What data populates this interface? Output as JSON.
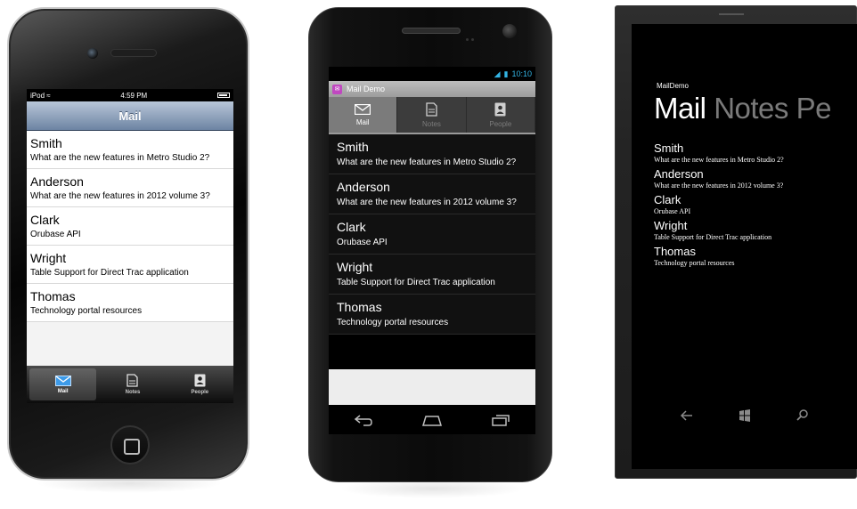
{
  "messages": [
    {
      "sender": "Smith",
      "subject": "What are the new features in Metro Studio 2?"
    },
    {
      "sender": "Anderson",
      "subject": "What are the new features in 2012 volume 3?"
    },
    {
      "sender": "Clark",
      "subject": "Orubase API"
    },
    {
      "sender": "Wright",
      "subject": "Table Support for Direct Trac application"
    },
    {
      "sender": "Thomas",
      "subject": "Technology portal resources"
    }
  ],
  "iphone": {
    "status": {
      "carrier": "iPod",
      "time": "4:59 PM"
    },
    "nav_title": "Mail",
    "tabs": [
      {
        "label": "Mail",
        "icon": "mail-icon"
      },
      {
        "label": "Notes",
        "icon": "notes-icon"
      },
      {
        "label": "People",
        "icon": "people-icon"
      }
    ]
  },
  "android": {
    "status": {
      "time": "10:10"
    },
    "app_title": "Mail Demo",
    "tabs": [
      {
        "label": "Mail",
        "icon": "mail-icon"
      },
      {
        "label": "Notes",
        "icon": "notes-icon"
      },
      {
        "label": "People",
        "icon": "people-icon"
      }
    ]
  },
  "winphone": {
    "app_title": "MailDemo",
    "pivot": [
      "Mail",
      "Notes",
      "Pe"
    ]
  },
  "colors": {
    "ios_nav": "#6d84a3",
    "android_accent": "#33b5e5",
    "wp_background": "#000000"
  }
}
